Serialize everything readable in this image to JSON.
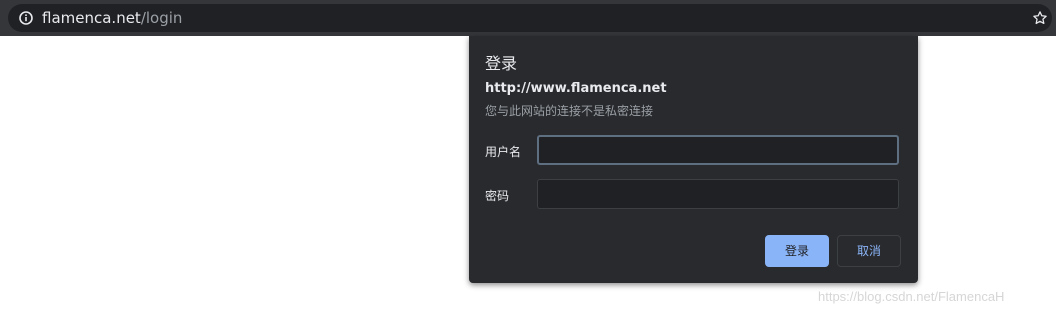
{
  "address_bar": {
    "domain": "flamenca.net",
    "path": "/login",
    "site_info_icon": "info-circle-icon",
    "bookmark_icon": "star-outline-icon"
  },
  "auth_dialog": {
    "title": "登录",
    "origin": "http://www.flamenca.net",
    "warning": "您与此网站的连接不是私密连接",
    "username_label": "用户名",
    "username_value": "",
    "password_label": "密码",
    "password_value": "",
    "sign_in_label": "登录",
    "cancel_label": "取消"
  },
  "watermark": "https://blog.csdn.net/FlamencaH",
  "colors": {
    "toolbar": "#35363a",
    "omnibox": "#202124",
    "dialog": "#292a2d",
    "accent": "#8ab4f8"
  }
}
